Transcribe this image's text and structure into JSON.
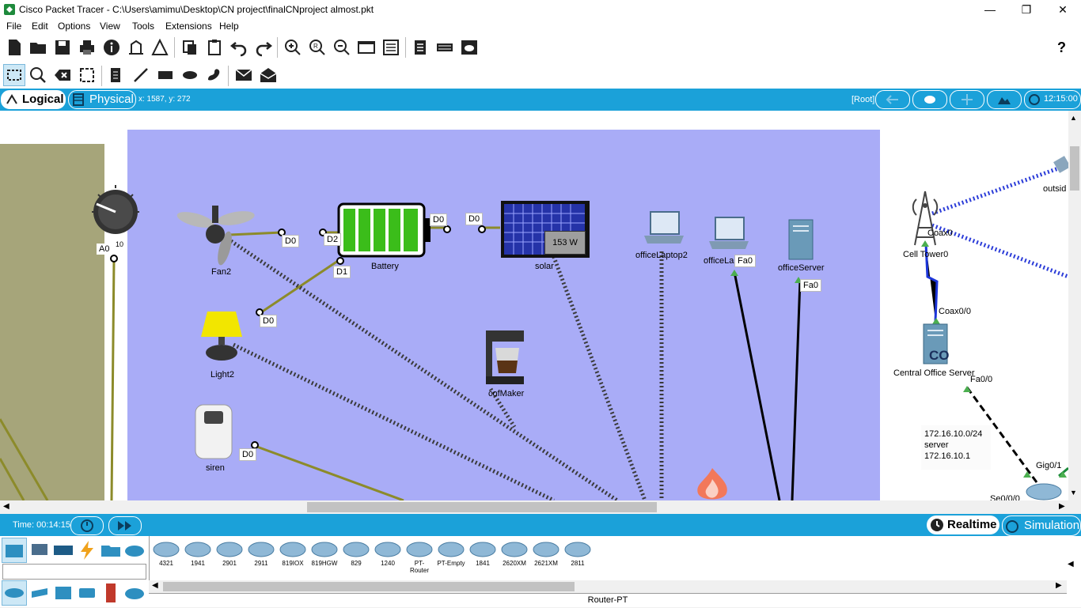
{
  "window": {
    "title": "Cisco Packet Tracer - C:\\Users\\amimu\\Desktop\\CN project\\finalCNproject almost.pkt"
  },
  "menu": [
    "File",
    "Edit",
    "Options",
    "View",
    "Tools",
    "Extensions",
    "Help"
  ],
  "toolbar": {
    "help_label": "?"
  },
  "modebar": {
    "logical": "Logical",
    "physical": "Physical",
    "coords": "x: 1587, y: 272",
    "root": "[Root]",
    "clock": "12:15:00"
  },
  "canvas": {
    "knob_a0": "A0",
    "knob_10": "10",
    "fan2": "Fan2",
    "battery": "Battery",
    "solar": "solar",
    "solar_watts": "153 W",
    "light2": "Light2",
    "siren": "siren",
    "cofmaker": "cofMaker",
    "office_laptop2": "officeLaptop2",
    "office_laptop": "officeLa",
    "office_server": "officeServer",
    "cell_tower": "Cell Tower0",
    "central_office": "Central Office Server",
    "co_badge": "CO",
    "outside": "outsid",
    "ports": {
      "fan_d0": "D0",
      "bat_d2": "D2",
      "bat_d0a": "D0",
      "bat_d0b": "D0",
      "bat_d1": "D1",
      "light_d0": "D0",
      "siren_d0": "D0",
      "laptop_fa0": "Fa0",
      "server_fa0": "Fa0",
      "coax0": "Coax0",
      "coax00": "Coax0/0",
      "fa00": "Fa0/0",
      "gig01": "Gig0/1",
      "se000": "Se0/0/0"
    },
    "note": {
      "line1": "172.16.10.0/24",
      "line2": "server",
      "line3": "172.16.10.1"
    }
  },
  "timebar": {
    "time": "Time: 00:14:15",
    "realtime": "Realtime",
    "simulation": "Simulation"
  },
  "devices": [
    "4321",
    "1941",
    "2901",
    "2911",
    "819IOX",
    "819HGW",
    "829",
    "1240",
    "PT-Router",
    "PT-Empty",
    "1841",
    "2620XM",
    "2621XM",
    "2811"
  ],
  "selected_device": "Router-PT",
  "colors": {
    "accent": "#1ba1d9",
    "workspace": "#a9acf7",
    "olive": "#a6a57a"
  }
}
